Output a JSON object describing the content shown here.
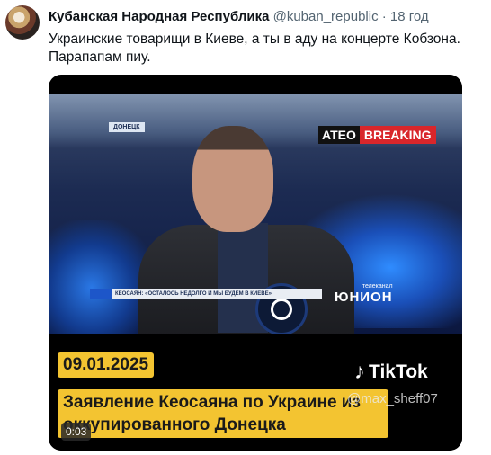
{
  "tweet": {
    "author_name": "Кубанская Народная Республика",
    "author_handle": "@kuban_republic",
    "separator": "·",
    "time_ago": "18 год",
    "text_line1": "Украинские товарищи в Киеве, а ты в аду на концерте Кобзона.",
    "text_line2": "Парапапам пиу."
  },
  "video": {
    "location_badge": "ДОНЕЦК",
    "breaking_left": "ATEO",
    "breaking_right": "BREAKING",
    "lower_third": "КЕОСАЯН: «ОСТАЛОСЬ НЕДОЛГО И МЫ БУДЕМ В КИЕВЕ»",
    "channel_small": "телеканал",
    "channel_name": "ЮНИОН",
    "date": "09.01.2025",
    "caption": "Заявление Кеосаяна по Украине из оккупированного Донецка",
    "tiktok_label": "TikTok",
    "tiktok_handle": "@max_sheff07",
    "timestamp": "0:03"
  },
  "icons": {
    "tiktok": "music-note-icon",
    "mic": "microphone-icon"
  },
  "colors": {
    "accent_yellow": "#f3c431",
    "breaking_red": "#d9262b"
  }
}
